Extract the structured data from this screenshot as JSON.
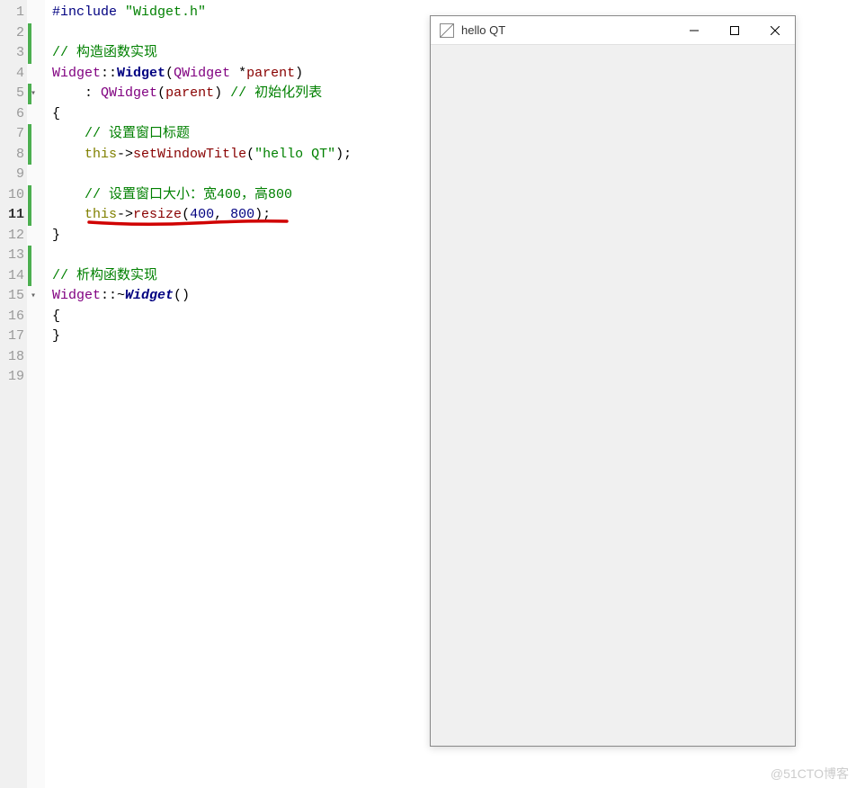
{
  "editor": {
    "line_numbers": [
      "1",
      "2",
      "3",
      "4",
      "5",
      "6",
      "7",
      "8",
      "9",
      "10",
      "11",
      "12",
      "13",
      "14",
      "15",
      "16",
      "17",
      "18",
      "19"
    ],
    "current_line": 11,
    "fold_markers": [
      {
        "line": 5,
        "symbol": "▾"
      },
      {
        "line": 15,
        "symbol": "▾"
      }
    ],
    "green_bars": [
      {
        "start": 2,
        "end": 3
      },
      {
        "start": 5,
        "end": 5
      },
      {
        "start": 7,
        "end": 8
      },
      {
        "start": 10,
        "end": 11
      },
      {
        "start": 13,
        "end": 14
      }
    ],
    "code": {
      "l1_include": "#include",
      "l1_header": "\"Widget.h\"",
      "l3_comment": "// 构造函数实现",
      "l4_class": "Widget",
      "l4_func": "Widget",
      "l4_type": "QWidget",
      "l4_param": "parent",
      "l5_ctor": "QWidget",
      "l5_arg": "parent",
      "l5_comment": "// 初始化列表",
      "l6_brace": "{",
      "l7_comment": "// 设置窗口标题",
      "l8_this": "this",
      "l8_method": "setWindowTitle",
      "l8_str": "\"hello QT\"",
      "l10_comment": "// 设置窗口大小：宽400，高800",
      "l11_this": "this",
      "l11_method": "resize",
      "l11_arg1": "400",
      "l11_arg2": "800",
      "l12_brace": "}",
      "l14_comment": "// 析构函数实现",
      "l15_class": "Widget",
      "l15_func": "Widget",
      "l16_brace": "{",
      "l17_brace": "}"
    }
  },
  "app_window": {
    "title": "hello QT"
  },
  "watermark": "@51CTO博客"
}
